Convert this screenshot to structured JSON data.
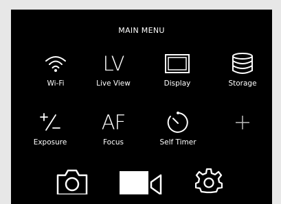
{
  "menu": {
    "title": "MAIN MENU",
    "items": [
      {
        "label": "Wi-Fi",
        "icon": "wifi-icon"
      },
      {
        "label": "Live View",
        "icon": "live-view-icon",
        "glyph": "LV"
      },
      {
        "label": "Display",
        "icon": "display-icon"
      },
      {
        "label": "Storage",
        "icon": "storage-icon"
      },
      {
        "label": "Exposure",
        "icon": "exposure-icon"
      },
      {
        "label": "Focus",
        "icon": "focus-icon",
        "glyph": "AF"
      },
      {
        "label": "Self Timer",
        "icon": "self-timer-icon"
      },
      {
        "label": "",
        "icon": "add-icon"
      }
    ],
    "bottom": [
      {
        "icon": "camera-icon"
      },
      {
        "icon": "video-camera-icon"
      },
      {
        "icon": "gear-icon"
      }
    ]
  },
  "colors": {
    "background": "#000000",
    "foreground": "#ffffff",
    "frame": "#e7e7e7"
  }
}
